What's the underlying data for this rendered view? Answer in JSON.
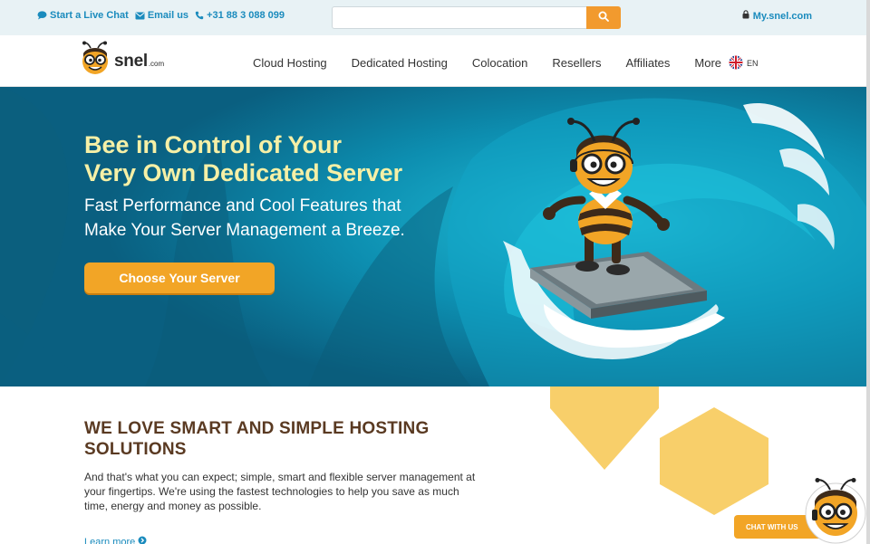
{
  "topbar": {
    "live_chat": "Start a Live Chat",
    "email": "Email us",
    "phone": "+31 88 3 088 099",
    "search_placeholder": "",
    "account": "My.snel.com",
    "icons": [
      "chat-bubble-icon",
      "envelope-icon",
      "phone-icon",
      "search-icon",
      "lock-icon"
    ]
  },
  "header": {
    "logo_text": "snel",
    "logo_suffix": ".com",
    "nav": [
      "Cloud Hosting",
      "Dedicated Hosting",
      "Colocation",
      "Resellers",
      "Affiliates",
      "More"
    ],
    "language": "EN"
  },
  "hero": {
    "title_line1": "Bee in Control of Your",
    "title_line2": "Very Own Dedicated Server",
    "subtitle_line1": "Fast Performance and Cool Features that",
    "subtitle_line2": "Make Your Server Management a Breeze.",
    "cta": "Choose Your Server"
  },
  "intro": {
    "title_line1": "WE LOVE SMART AND SIMPLE HOSTING",
    "title_line2": "SOLUTIONS",
    "body_line1": "And that's what you can expect; simple, smart and flexible server management at",
    "body_line2": "your fingertips. We're using the fastest technologies to help you save as much",
    "body_line3": "time, energy and money as possible.",
    "learn_more": "Learn more"
  },
  "chat": {
    "label": "CHAT WITH US"
  },
  "colors": {
    "accent_orange": "#f2a526",
    "link_blue": "#1a8bbd",
    "hero_teal": "#0b6f8e",
    "title_brown": "#5a3a22",
    "hero_title_yellow": "#f6f0a6",
    "hex_yellow": "#f8cf6a"
  }
}
